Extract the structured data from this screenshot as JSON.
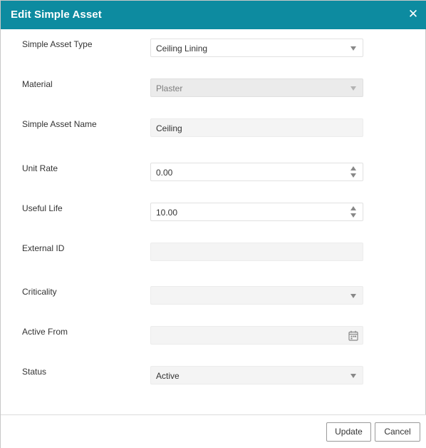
{
  "dialog": {
    "title": "Edit Simple Asset",
    "close_symbol": "✕"
  },
  "fields": {
    "simple_asset_type": {
      "label": "Simple Asset Type",
      "value": "Ceiling Lining"
    },
    "material": {
      "label": "Material",
      "value": "Plaster"
    },
    "simple_asset_name": {
      "label": "Simple Asset Name",
      "value": "Ceiling"
    },
    "unit_rate": {
      "label": "Unit Rate",
      "value": "0.00"
    },
    "useful_life": {
      "label": "Useful Life",
      "value": "10.00"
    },
    "external_id": {
      "label": "External ID",
      "value": ""
    },
    "criticality": {
      "label": "Criticality",
      "value": ""
    },
    "active_from": {
      "label": "Active From",
      "value": ""
    },
    "status": {
      "label": "Status",
      "value": "Active"
    }
  },
  "footer": {
    "update_label": "Update",
    "cancel_label": "Cancel"
  },
  "colors": {
    "titlebar": "#0d8ba0",
    "disabled_field": "#ebebeb",
    "filled_field": "#f4f4f4"
  },
  "icons": [
    "close-icon",
    "dropdown-caret-icon",
    "spinner-up-icon",
    "spinner-down-icon",
    "calendar-icon"
  ]
}
